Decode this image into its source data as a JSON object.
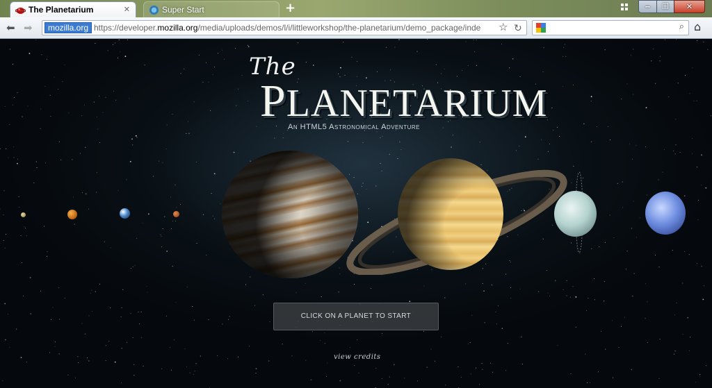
{
  "browser": {
    "tabs": [
      {
        "title": "The Planetarium",
        "active": true
      },
      {
        "title": "Super Start",
        "active": false
      }
    ],
    "address": {
      "domain_badge": "mozilla.org",
      "url_prefix": "https://developer.",
      "url_host": "mozilla.org",
      "url_path": "/media/uploads/demos/l/i/littleworkshop/the-planetarium/demo_package/inde"
    },
    "search_placeholder": "",
    "colors": {
      "accent": "#3c7bd2",
      "close": "#c7412b"
    }
  },
  "page": {
    "title_the": "The",
    "title_main_first": "P",
    "title_main_rest": "LANETARIUM",
    "subtitle": "An HTML5 Astronomical Adventure",
    "start_button": "Click on a planet to start",
    "credits_link": "view credits",
    "planets": [
      {
        "name": "Mercury",
        "icon": "mercury-planet"
      },
      {
        "name": "Venus",
        "icon": "venus-planet"
      },
      {
        "name": "Earth",
        "icon": "earth-planet"
      },
      {
        "name": "Mars",
        "icon": "mars-planet"
      },
      {
        "name": "Jupiter",
        "icon": "jupiter-planet"
      },
      {
        "name": "Saturn",
        "icon": "saturn-planet"
      },
      {
        "name": "Uranus",
        "icon": "uranus-planet"
      },
      {
        "name": "Neptune",
        "icon": "neptune-planet"
      }
    ]
  }
}
